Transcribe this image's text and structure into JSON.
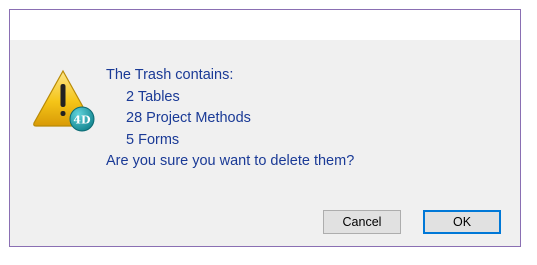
{
  "dialog": {
    "icon": "warning-4d-icon",
    "message_lines": [
      "The Trash contains:",
      "2 Tables",
      "28 Project Methods",
      "5 Forms",
      "Are you sure you want to delete them?"
    ],
    "cancel_label": "Cancel",
    "ok_label": "OK",
    "badge_text": "4D"
  },
  "colors": {
    "message_text": "#1a3a96",
    "border": "#8a6fb3",
    "focus_border": "#0078d7",
    "warning_yellow": "#f5c518",
    "badge_teal": "#1a9ca8"
  }
}
